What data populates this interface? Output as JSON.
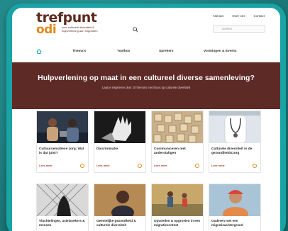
{
  "logo": {
    "word_top": "trefpunt",
    "word_bottom": "odi",
    "tagline": "voor culturele diversiteit & hulpverlening aan migranten"
  },
  "toplinks": [
    "Nieuws",
    "Over ons",
    "Contact"
  ],
  "search": {
    "placeholder": "Zoeken"
  },
  "nav": {
    "home_icon": "home-icon",
    "items": [
      "Thema's",
      "Toolbox",
      "Sprekers",
      "Vormingen & Events"
    ]
  },
  "hero": {
    "title": "Hulpverlening op maat in een cultureel diverse samenleving?",
    "subtitle": "Laat je inspireren door 10 thema's met focus op culturele diversiteit"
  },
  "cards_row1": [
    {
      "title": "Cultuursensitieve zorg: Wat is dat juist?",
      "more": "Lees meer"
    },
    {
      "title": "Discriminatie",
      "more": "Lees meer"
    },
    {
      "title": "Communiceren met anderstaligen",
      "more": "Lees meer"
    },
    {
      "title": "Culturele diversiteit in de gezondheidszorg",
      "more": "Lees meer"
    }
  ],
  "cards_row2": [
    {
      "title": "Vluchtelingen, asielzoekers & mensen"
    },
    {
      "title": "Geestelijke gezondheid & culturele diversiteit"
    },
    {
      "title": "Opvoeden & opgroeien in een migratiecontext"
    },
    {
      "title": "Ouderen met een migratieachtergrond"
    }
  ],
  "colors": {
    "brand_brown": "#5e2a25",
    "brand_orange": "#e08a1e",
    "frame_teal": "#1aa3a4"
  }
}
